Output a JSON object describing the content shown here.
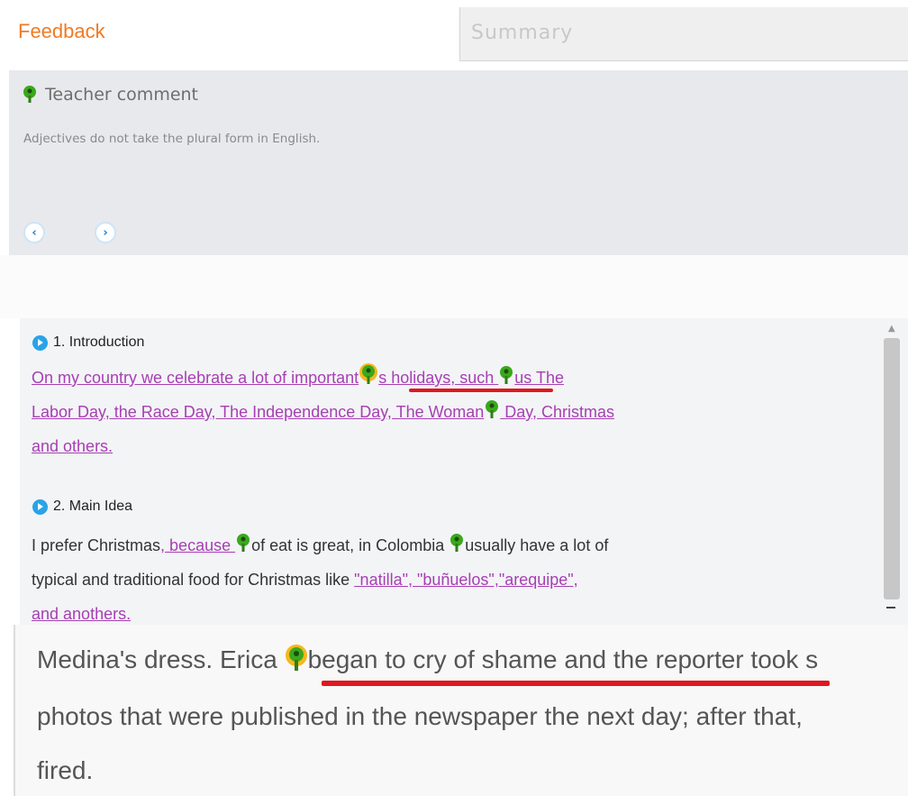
{
  "tabs": {
    "feedback_label": "Feedback",
    "summary_label": "Summary"
  },
  "comment": {
    "title": "Teacher comment",
    "text": "Adjectives do not take the plural form in English.",
    "prev_icon": "chevron-left-icon",
    "next_icon": "chevron-right-icon"
  },
  "essay": {
    "sections": [
      {
        "heading": "1. Introduction",
        "line1_a": "On my country we celebrate a lot of ",
        "line1_b": "important",
        "line1_c": "s holidays, such ",
        "line1_d": "us  The",
        "line2_a": "Labor Day, the Race Day, The Independence Day, The Woman",
        "line2_b": " Day, Christmas",
        "line3": "and others."
      },
      {
        "heading": "2. Main Idea",
        "line1_a": "I prefer Christmas",
        "line1_b": ", because ",
        "line1_c": "of eat is great, in Colombia ",
        "line1_d": "usually have a lot of",
        "line2_a": "typical and traditional food for Christmas like  ",
        "line2_b": "\"natilla\", \"buñuelos\",\"arequipe\",",
        "line3": "and anothers."
      }
    ]
  },
  "zoomed": {
    "line1_a": "Medina's dress. Erica ",
    "line1_b": "began to cry of shame and the reporter",
    "line1_c": "  took s",
    "line2": "photos that were published in the newspaper the next day; after that,",
    "line3": "fired."
  },
  "colors": {
    "accent": "#f07a22",
    "pin_green": "#3aa81c",
    "pin_highlight": "#f5b81c",
    "error_underline": "#e0181f",
    "essay_text": "#a63fb3",
    "link_blue": "#2aa3e6"
  }
}
